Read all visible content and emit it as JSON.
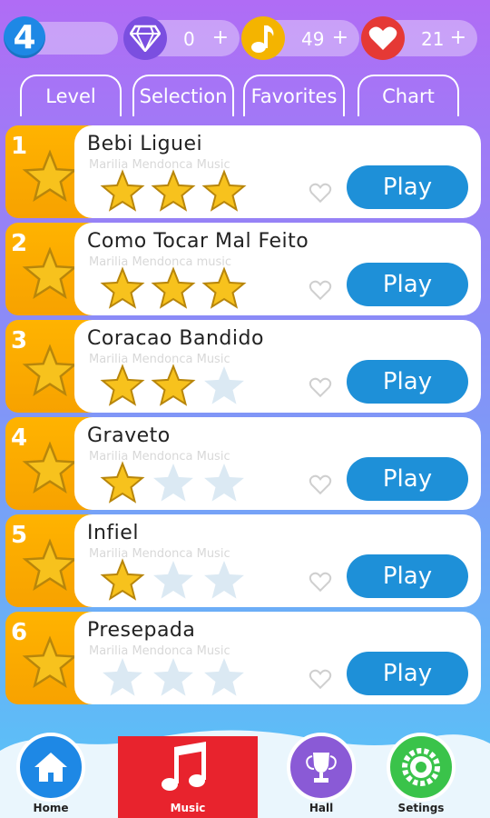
{
  "header": {
    "level": "4",
    "diamonds": {
      "value": "0",
      "plus": "+"
    },
    "notes": {
      "value": "49",
      "plus": "+"
    },
    "hearts": {
      "value": "21",
      "plus": "+"
    }
  },
  "tabs": [
    {
      "label": "Level"
    },
    {
      "label": "Selection"
    },
    {
      "label": "Favorites"
    },
    {
      "label": "Chart"
    }
  ],
  "songs": [
    {
      "rank": "1",
      "title": "Bebi Liguei",
      "artist": "Marilia Mendonca Music",
      "stars": 3,
      "play_label": "Play"
    },
    {
      "rank": "2",
      "title": "Como Tocar Mal Feito",
      "artist": "Marilia Mendonca music",
      "stars": 3,
      "play_label": "Play"
    },
    {
      "rank": "3",
      "title": "Coracao Bandido",
      "artist": "Marilia Mendonca Music",
      "stars": 2,
      "play_label": "Play"
    },
    {
      "rank": "4",
      "title": "Graveto",
      "artist": "Marilia Mendonca Music",
      "stars": 1,
      "play_label": "Play"
    },
    {
      "rank": "5",
      "title": "Infiel",
      "artist": "Marilia Mendonca Music",
      "stars": 1,
      "play_label": "Play"
    },
    {
      "rank": "6",
      "title": "Presepada",
      "artist": "Marilia Mendonca Music",
      "stars": 0,
      "play_label": "Play"
    }
  ],
  "nav": {
    "home": "Home",
    "music": "Music",
    "hall": "Hall",
    "settings": "Setings"
  },
  "colors": {
    "play": "#1e90d8",
    "rank_bg": "#ffb300",
    "music_active": "#e8232d"
  }
}
